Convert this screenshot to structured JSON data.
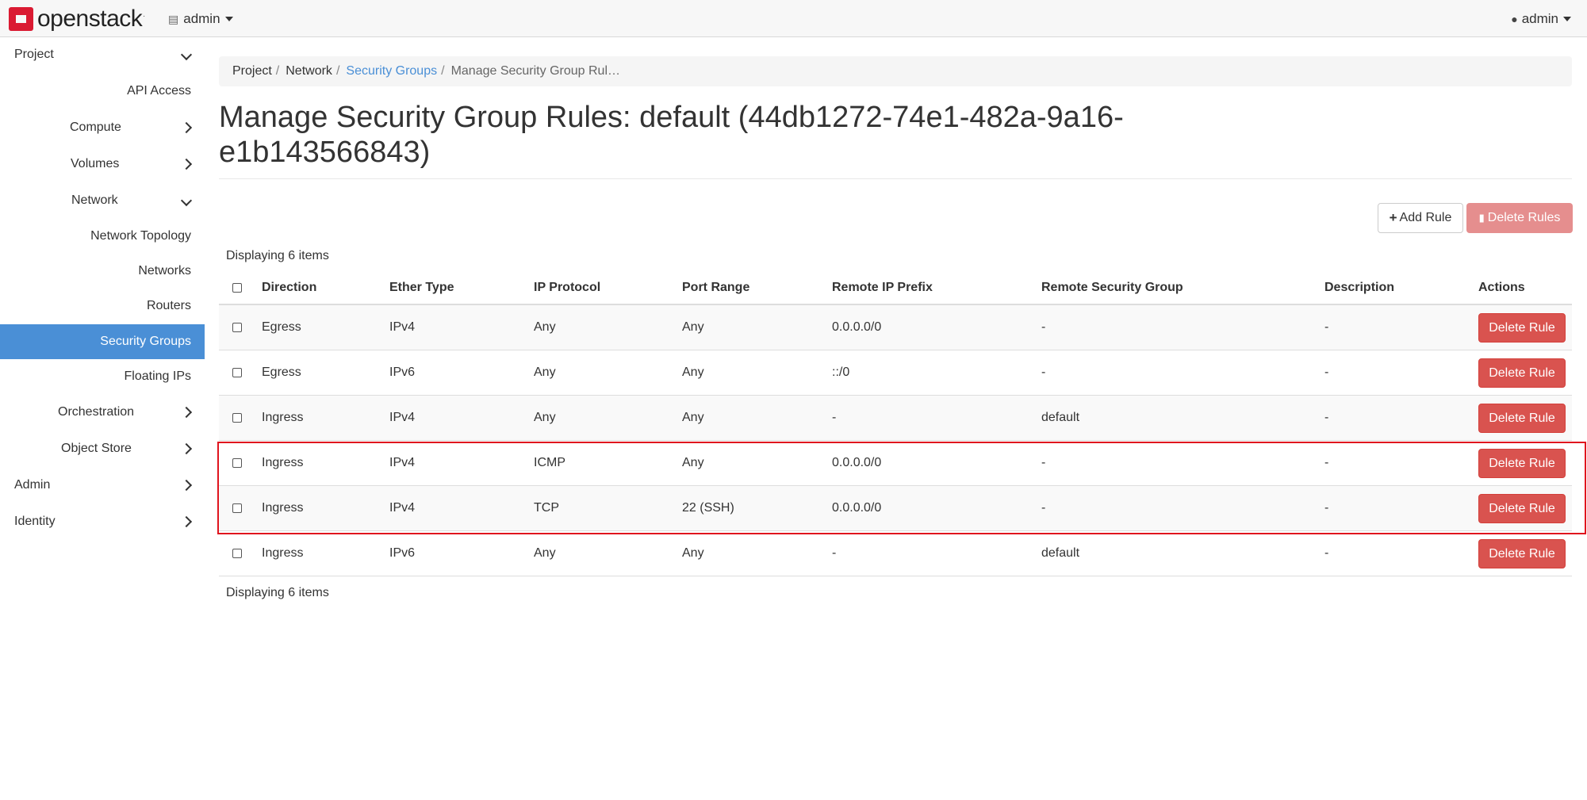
{
  "navbar": {
    "brand": "openstack",
    "brand_tm": ".",
    "project": "admin",
    "user": "admin",
    "project_icon": "table-icon",
    "user_icon": "user-icon"
  },
  "sidebar": {
    "items": [
      {
        "label": "Project",
        "chevron": "down"
      },
      {
        "label": "API Access"
      },
      {
        "label": "Compute",
        "chevron": "right"
      },
      {
        "label": "Volumes",
        "chevron": "right"
      },
      {
        "label": "Network",
        "chevron": "down"
      },
      {
        "label": "Network Topology"
      },
      {
        "label": "Networks"
      },
      {
        "label": "Routers"
      },
      {
        "label": "Security Groups",
        "active": true
      },
      {
        "label": "Floating IPs"
      },
      {
        "label": "Orchestration",
        "chevron": "right"
      },
      {
        "label": "Object Store",
        "chevron": "right"
      },
      {
        "label": "Admin",
        "chevron": "right"
      },
      {
        "label": "Identity",
        "chevron": "right"
      }
    ]
  },
  "breadcrumb": {
    "items": [
      "Project",
      "Network",
      "Security Groups",
      "Manage Security Group Rul…"
    ],
    "separator": "/"
  },
  "page": {
    "title_line1": "Manage Security Group Rules: default (44db1272-74e1-482a-9a16-",
    "title_line2": "e1b143566843)"
  },
  "actions": {
    "add_rule": "Add Rule",
    "delete_rules": "Delete Rules"
  },
  "table": {
    "count_top": "Displaying 6 items",
    "count_bottom": "Displaying 6 items",
    "columns": [
      "Direction",
      "Ether Type",
      "IP Protocol",
      "Port Range",
      "Remote IP Prefix",
      "Remote Security Group",
      "Description",
      "Actions"
    ],
    "row_action": "Delete Rule",
    "rows": [
      [
        "Egress",
        "IPv4",
        "Any",
        "Any",
        "0.0.0.0/0",
        "-",
        "-"
      ],
      [
        "Egress",
        "IPv6",
        "Any",
        "Any",
        "::/0",
        "-",
        "-"
      ],
      [
        "Ingress",
        "IPv4",
        "Any",
        "Any",
        "-",
        "default",
        "-"
      ],
      [
        "Ingress",
        "IPv4",
        "ICMP",
        "Any",
        "0.0.0.0/0",
        "-",
        "-"
      ],
      [
        "Ingress",
        "IPv4",
        "TCP",
        "22 (SSH)",
        "0.0.0.0/0",
        "-",
        "-"
      ],
      [
        "Ingress",
        "IPv6",
        "Any",
        "Any",
        "-",
        "default",
        "-"
      ]
    ]
  },
  "colors": {
    "accent": "#4a8fd6",
    "danger": "#d9534f",
    "danger_disabled": "#e58e8e",
    "highlight": "#e0141e",
    "brand_red": "#da1a32"
  }
}
